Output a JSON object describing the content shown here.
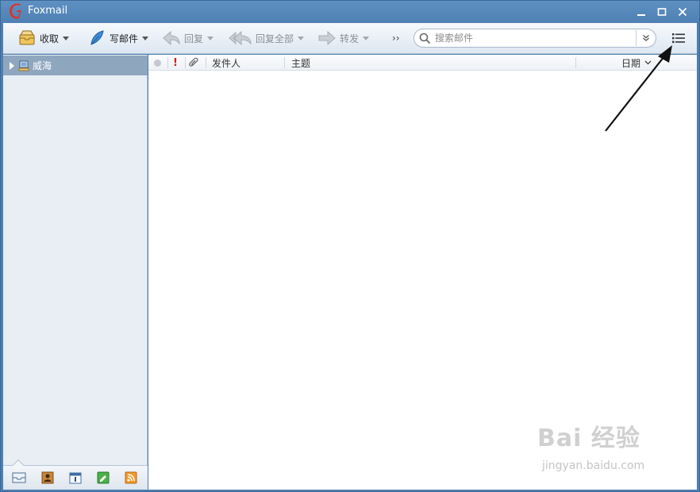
{
  "window": {
    "title": "Foxmail"
  },
  "toolbar": {
    "receive_label": "收取",
    "compose_label": "写邮件",
    "reply_label": "回复",
    "reply_all_label": "回复全部",
    "forward_label": "转发",
    "more_label": "››"
  },
  "search": {
    "placeholder": "搜索邮件",
    "value": ""
  },
  "sidebar": {
    "account_label": "威海"
  },
  "message_list": {
    "columns": {
      "sender": "发件人",
      "subject": "主题",
      "date": "日期"
    },
    "rows": []
  },
  "watermark": {
    "logo": "Bai 经验",
    "url": "jingyan.baidu.com"
  },
  "colors": {
    "titlebar": "#4f80b3",
    "sidebar_selected": "#8fa6bf",
    "flag": "#d21c1c"
  }
}
